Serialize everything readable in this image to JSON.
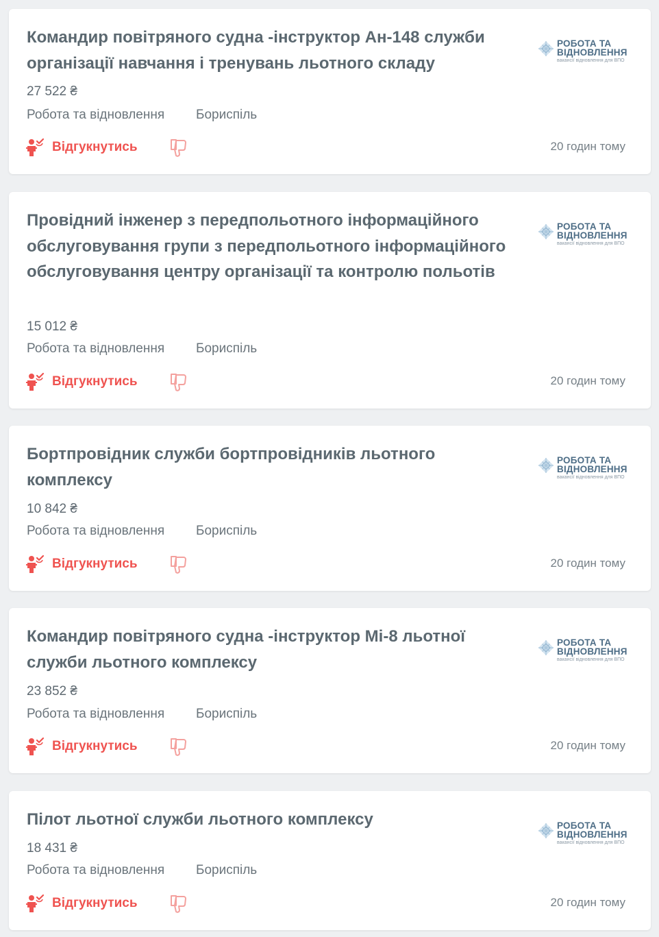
{
  "jobs": [
    {
      "title": "Командир повітряного судна -інструктор Ан-148 служби організації навчання і тренувань льотного складу",
      "salary": "27 522 ₴",
      "company": "Робота та відновлення",
      "city": "Бориспіль",
      "apply_label": "Відгукнутись",
      "posted": "20 годин тому"
    },
    {
      "title": "Провідний інженер з передпольотного інформаційного обслуговування групи з передпольотного інформаційного обслуговування центру організації та контролю польотів",
      "salary": "15 012 ₴",
      "company": "Робота та відновлення",
      "city": "Бориспіль",
      "apply_label": "Відгукнутись",
      "posted": "20 годин тому"
    },
    {
      "title": "Бортпровідник служби бортпровідників льотного комплексу",
      "salary": "10 842 ₴",
      "company": "Робота та відновлення",
      "city": "Бориспіль",
      "apply_label": "Відгукнутись",
      "posted": "20 годин тому"
    },
    {
      "title": "Командир повітряного судна -інструктор Мі-8 льотної служби льотного комплексу",
      "salary": "23 852 ₴",
      "company": "Робота та відновлення",
      "city": "Бориспіль",
      "apply_label": "Відгукнутись",
      "posted": "20 годин тому"
    },
    {
      "title": "Пілот льотної служби льотного комплексу",
      "salary": "18 431 ₴",
      "company": "Робота та відновлення",
      "city": "Бориспіль",
      "apply_label": "Відгукнутись",
      "posted": "20 годин тому"
    }
  ],
  "logo": {
    "line1": "РОБОТА ТА",
    "line2": "ВІДНОВЛЕННЯ",
    "tagline": "вакансії відновлення для ВПО"
  },
  "icons": {
    "apply": "person-check-icon",
    "dislike": "thumbs-down-icon",
    "logo_mark": "diamond-grid-logo-icon"
  },
  "colors": {
    "accent": "#ef5350",
    "title": "#5b6870",
    "logo_text": "#4d6d86",
    "logo_mark": "#a9c6dc",
    "background": "#eef0f2",
    "card": "#ffffff"
  }
}
